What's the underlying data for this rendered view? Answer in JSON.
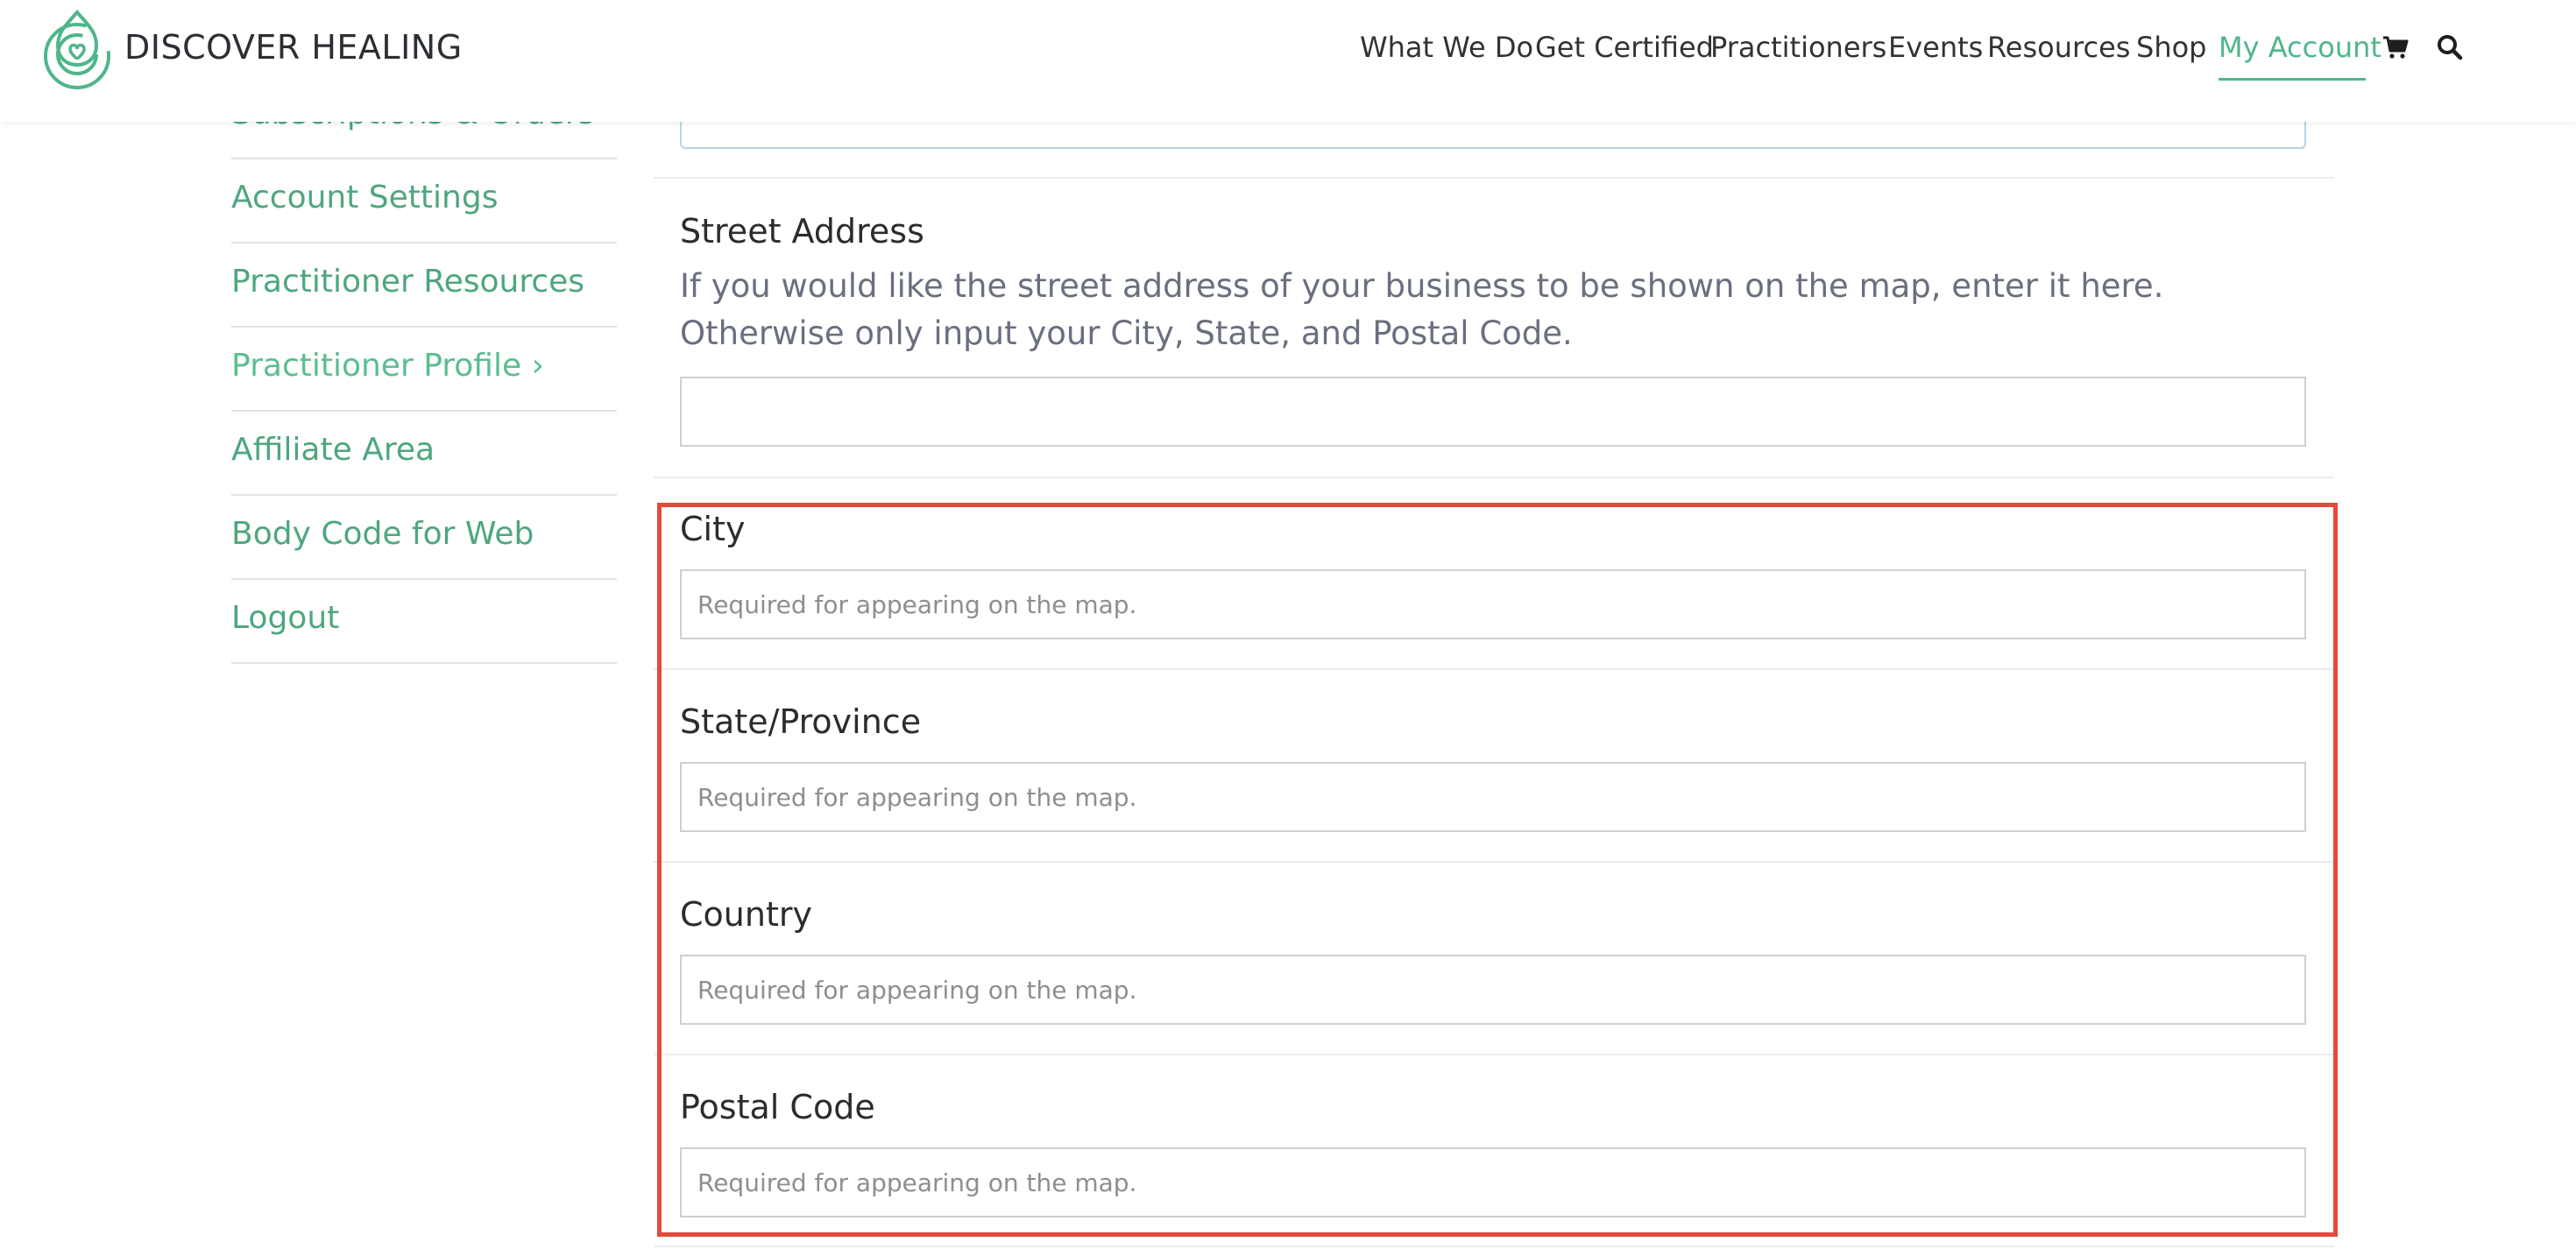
{
  "brand": {
    "name": "DISCOVER HEALING",
    "color": "#4fb68b"
  },
  "nav": {
    "items": [
      {
        "label": "What We Do"
      },
      {
        "label": "Get Certified"
      },
      {
        "label": "Practitioners"
      },
      {
        "label": "Events"
      },
      {
        "label": "Resources"
      },
      {
        "label": "Shop"
      },
      {
        "label": "My Account",
        "active": true
      }
    ],
    "icons": [
      "cart-icon",
      "search-icon"
    ]
  },
  "sidebar": {
    "items": [
      {
        "label": "Subscriptions & Orders"
      },
      {
        "label": "Account Settings"
      },
      {
        "label": "Practitioner Resources"
      },
      {
        "label": "Practitioner Profile ›",
        "active": true
      },
      {
        "label": "Affiliate Area"
      },
      {
        "label": "Body Code for Web"
      },
      {
        "label": "Logout"
      }
    ]
  },
  "form": {
    "street_address": {
      "label": "Street Address",
      "help": "If you would like the street address of your business to be shown on the map, enter it here. Otherwise only input your City, State, and Postal Code.",
      "value": ""
    },
    "city": {
      "label": "City",
      "placeholder": "Required for appearing on the map."
    },
    "state": {
      "label": "State/Province",
      "placeholder": "Required for appearing on the map."
    },
    "country": {
      "label": "Country",
      "placeholder": "Required for appearing on the map."
    },
    "postal": {
      "label": "Postal Code",
      "placeholder": "Required for appearing on the map."
    }
  },
  "colors": {
    "accent_green": "#4fb68b",
    "highlight_red": "#e24a3b",
    "text_dark": "#2c2c2c",
    "help_text": "#6a6f80"
  }
}
